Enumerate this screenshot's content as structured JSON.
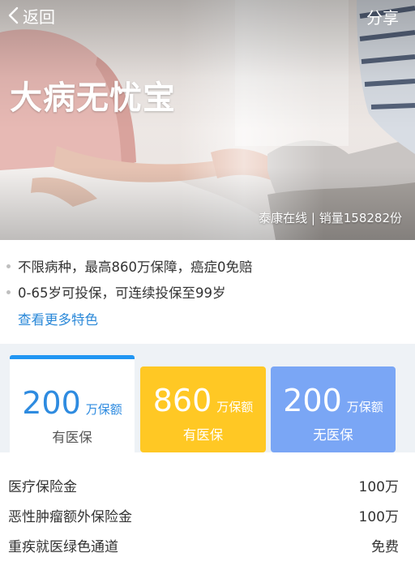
{
  "topbar": {
    "back_label": "返回",
    "share_label": "分享"
  },
  "hero": {
    "title": "大病无忧宝",
    "meta": "泰康在线 | 销量158282份"
  },
  "features": {
    "items": [
      "不限病种，最高860万保障，癌症0免赔",
      "0-65岁可投保，可连续投保至99岁"
    ],
    "more_label": "查看更多特色"
  },
  "plans": [
    {
      "amount": "200",
      "unit": "万保额",
      "subtitle": "有医保",
      "selected": true
    },
    {
      "amount": "860",
      "unit": "万保额",
      "subtitle": "有医保",
      "selected": false
    },
    {
      "amount": "200",
      "unit": "万保额",
      "subtitle": "无医保",
      "selected": false
    }
  ],
  "benefits": [
    {
      "name": "医疗保险金",
      "value": "100万"
    },
    {
      "name": "恶性肿瘤额外保险金",
      "value": "100万"
    },
    {
      "name": "重疾就医绿色通道",
      "value": "免费"
    }
  ],
  "colors": {
    "accent_blue": "#2196f3",
    "link_blue": "#2a88d8",
    "card_yellow": "#ffc824",
    "card_blue": "#7aa6f5"
  }
}
